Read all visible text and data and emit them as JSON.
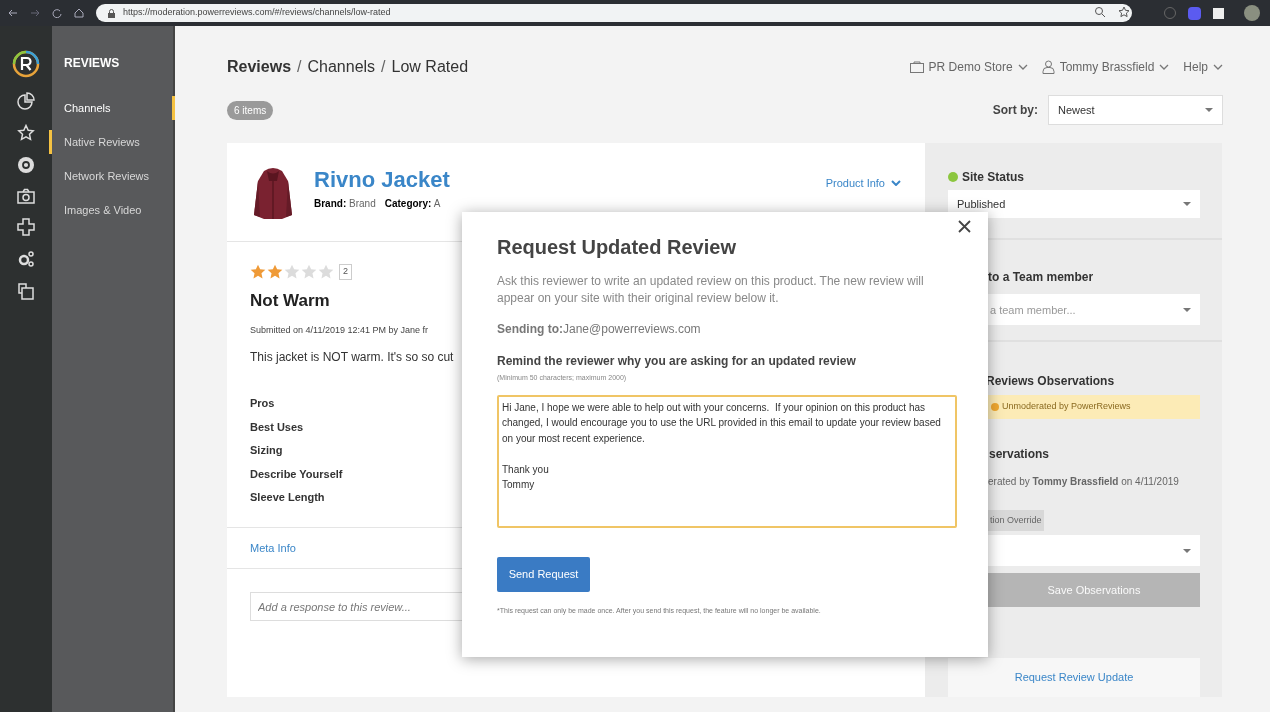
{
  "browser": {
    "url": "https://moderation.powerreviews.com/#/reviews/channels/low-rated"
  },
  "sidebar": {
    "title": "REVIEWS",
    "items": [
      {
        "label": "Channels",
        "selected": true,
        "current": false
      },
      {
        "label": "Native Reviews",
        "selected": false,
        "current": true
      },
      {
        "label": "Network Reviews",
        "selected": false,
        "current": false
      },
      {
        "label": "Images & Video",
        "selected": false,
        "current": false
      }
    ]
  },
  "breadcrumb": [
    "Reviews",
    "Channels",
    "Low Rated"
  ],
  "breadcrumb_separator": "/",
  "header_menus": [
    {
      "kind": "store",
      "label": "PR Demo Store"
    },
    {
      "kind": "user",
      "label": "Tommy Brassfield"
    },
    {
      "kind": "help",
      "label": "Help"
    }
  ],
  "count_badge": "6 items",
  "sort": {
    "label": "Sort by:",
    "value": "Newest"
  },
  "product": {
    "name": "Rivno Jacket",
    "brand_label": "Brand:",
    "brand": "Brand",
    "category_label": "Category:",
    "category": "A",
    "info_link": "Product Info"
  },
  "review": {
    "stars": 2,
    "rating": "2",
    "title": "Not Warm",
    "submitted": "Submitted on 4/11/2019 12:41 PM by Jane fr",
    "body": "This jacket is NOT warm. It's so so cut",
    "attributes": [
      "Pros",
      "Best Uses",
      "Sizing",
      "Describe Yourself",
      "Sleeve Length"
    ],
    "meta_link": "Meta Info",
    "response_placeholder": "Add a response to this review..."
  },
  "side_panel": {
    "site_status": {
      "title": "Site Status",
      "color": "#8cc63f",
      "value": "Published"
    },
    "assign": {
      "title": "to a Team member",
      "placeholder": "a team member..."
    },
    "observations_title": "Reviews Observations",
    "notice": "Unmoderated by PowerReviews",
    "observations_subtitle": "servations",
    "moderated_by": "erated by **Tommy Brassfield** on 4/11/2019",
    "override_tag": "tion Override",
    "save_button": {
      "label": "Save Observations",
      "disabled": true
    },
    "request_link": "Request Review Update"
  },
  "modal": {
    "title": "Request Updated Review",
    "description": "Ask this reviewer to write an updated review on this product. The new review will appear on your site with their original review below it.",
    "sending_to": "**Sending to:**Jane@powerreviews.com",
    "prompt": "Remind the reviewer why you are asking for an updated review",
    "hint": "(Minimum 50 characters; maximum 2000)",
    "message": "Hi Jane, I hope we were able to help out with your concerns.  If your opinion on this product has changed, I would encourage you to use the URL provided in this email to update your review based on your most recent experience.\n\nThank you\nTommy",
    "button": "Send Request",
    "footnote": "*This request can only be made once. After you send this request, the feature will no longer be available."
  }
}
